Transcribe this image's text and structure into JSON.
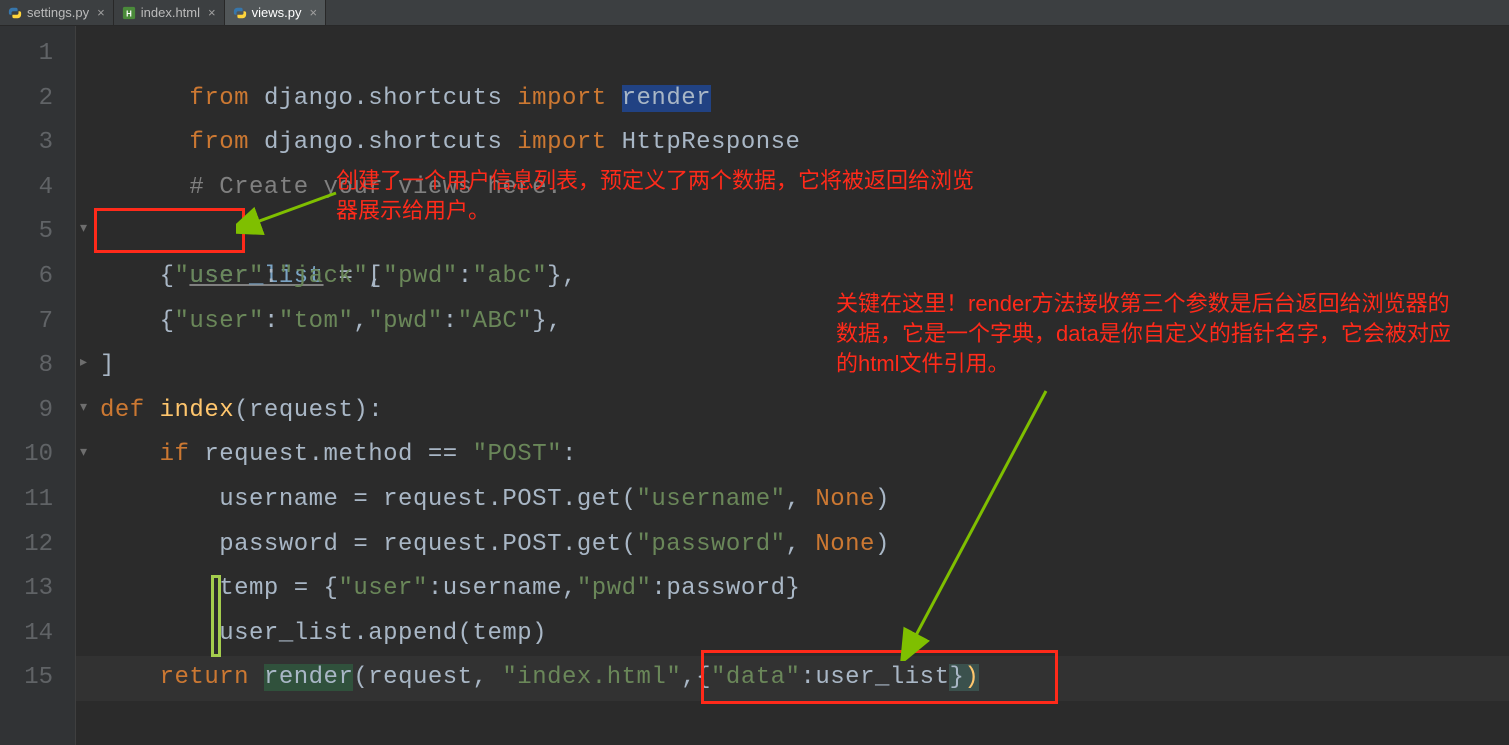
{
  "tabs": [
    {
      "label": "settings.py",
      "icon": "python-icon",
      "active": false
    },
    {
      "label": "index.html",
      "icon": "html-icon",
      "active": false
    },
    {
      "label": "views.py",
      "icon": "python-icon",
      "active": true
    }
  ],
  "line_numbers": [
    "1",
    "2",
    "3",
    "4",
    "5",
    "6",
    "7",
    "8",
    "9",
    "10",
    "11",
    "12",
    "13",
    "14",
    "15"
  ],
  "code": {
    "l1": {
      "from": "from",
      "pkg": "django.shortcuts",
      "imp": "import",
      "name": "render"
    },
    "l2": {
      "from": "from",
      "pkg": "django.shortcuts",
      "imp": "import",
      "name": "HttpResponse"
    },
    "l3": {
      "text": "# Create your views here."
    },
    "l5": {
      "var": "user_list",
      "text": " = ["
    },
    "l6": {
      "indent": "    ",
      "obr": "{",
      "k1": "\"user\"",
      "c1": ":",
      "v1": "\"jack\"",
      "cm": ",",
      "k2": "\"pwd\"",
      "c2": ":",
      "v2": "\"abc\"",
      "cbr": "},"
    },
    "l7": {
      "indent": "    ",
      "obr": "{",
      "k1": "\"user\"",
      "c1": ":",
      "v1": "\"tom\"",
      "cm": ",",
      "k2": "\"pwd\"",
      "c2": ":",
      "v2": "\"ABC\"",
      "cbr": "},"
    },
    "l8": {
      "text": "]"
    },
    "l9": {
      "def": "def ",
      "fn": "index",
      "params": "(request):"
    },
    "l10": {
      "indent": "    ",
      "kw": "if",
      "expr": " request.method == ",
      "str": "\"POST\"",
      "colon": ":"
    },
    "l11": {
      "indent": "        ",
      "var": "username",
      "eq": " = request.POST.get(",
      "str": "\"username\"",
      "cm": ", ",
      "none": "None",
      "end": ")"
    },
    "l12": {
      "indent": "        ",
      "var": "password",
      "eq": " = request.POST.get(",
      "str": "\"password\"",
      "cm": ", ",
      "none": "None",
      "end": ")"
    },
    "l13": {
      "indent": "        ",
      "var": "temp",
      "eq": " = {",
      "k1": "\"user\"",
      "c1": ":",
      "v1": "username",
      "cm": ",",
      "k2": "\"pwd\"",
      "c2": ":",
      "v2": "password",
      "end": "}"
    },
    "l14": {
      "indent": "        ",
      "call": "user_list.append(temp)"
    },
    "l15": {
      "indent": "    ",
      "kw": "return ",
      "fn": "render",
      "open": "(request, ",
      "str": "\"index.html\"",
      "cm": ",{",
      "k": "\"data\"",
      "col": ":",
      "v": "user_list",
      "end": "})"
    }
  },
  "annotations": {
    "top": "创建了一个用户信息列表，预定义了两个数据，它将被返回给浏览器展示给用户。",
    "right_l1": "关键在这里！render方法接收第三个参数是后台返回给浏览器的",
    "right_l2": "数据，它是一个字典，data是你自定义的指针名字，它会被对应",
    "right_l3": "的html文件引用。"
  }
}
